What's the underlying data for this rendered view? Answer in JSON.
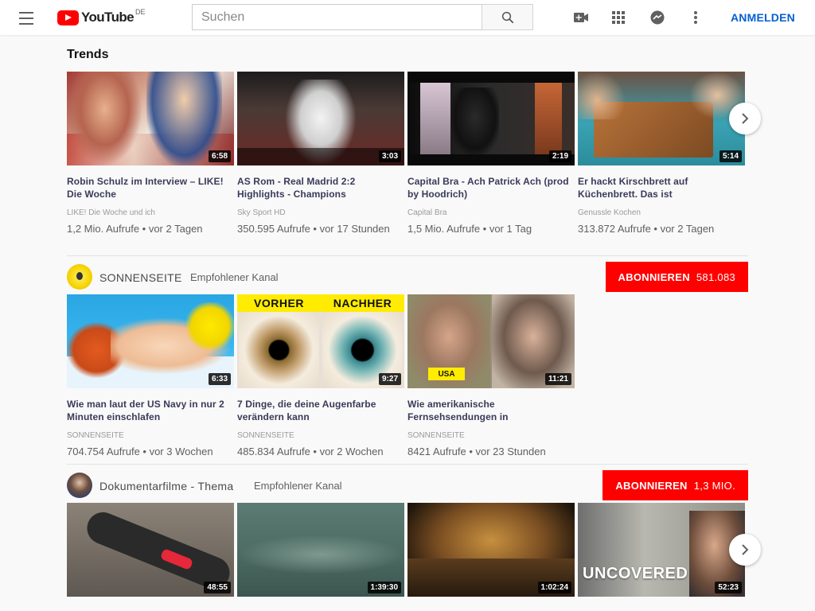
{
  "header": {
    "logo_text": "YouTube",
    "region": "DE",
    "search_placeholder": "Suchen",
    "signin_label": "ANMELDEN"
  },
  "trending": {
    "title": "Trends",
    "videos": [
      {
        "title": "Robin Schulz im Interview – LIKE! Die Woche",
        "channel": "LIKE! Die Woche und ich",
        "meta": "1,2 Mio. Aufrufe • vor 2 Tagen",
        "duration": "6:58"
      },
      {
        "title": "AS Rom - Real Madrid 2:2 Highlights - Champions",
        "channel": "Sky Sport HD",
        "meta": "350.595 Aufrufe • vor 17 Stunden",
        "duration": "3:03"
      },
      {
        "title": "Capital Bra - Ach Patrick Ach (prod by Hoodrich)",
        "channel": "Capital Bra",
        "meta": "1,5 Mio. Aufrufe • vor 1 Tag",
        "duration": "2:19"
      },
      {
        "title": "Er hackt Kirschbrett auf Küchenbrett. Das ist",
        "channel": "Genussle Kochen",
        "meta": "313.872 Aufrufe • vor 2 Tagen",
        "duration": "5:14"
      }
    ]
  },
  "channel1": {
    "name": "SONNENSEITE",
    "tag": "Empfohlener Kanal",
    "subscribe_label": "ABONNIEREN",
    "subscribe_count": "581.083",
    "videos": [
      {
        "title": "Wie man laut der US Navy in nur 2 Minuten einschlafen",
        "channel": "SONNENSEITE",
        "meta": "704.754 Aufrufe • vor 3 Wochen",
        "duration": "6:33"
      },
      {
        "title": "7 Dinge, die deine Augenfarbe verändern kann",
        "channel": "SONNENSEITE",
        "meta": "485.834 Aufrufe • vor 2 Wochen",
        "duration": "9:27",
        "banner_left": "VORHER",
        "banner_right": "NACHHER"
      },
      {
        "title": "Wie amerikanische Fernsehsendungen in",
        "channel": "SONNENSEITE",
        "meta": "8421 Aufrufe • vor 23 Stunden",
        "duration": "11:21",
        "badge_left": "USA"
      }
    ]
  },
  "channel2": {
    "name": "Dokumentarfilme - Thema",
    "tag": "Empfohlener Kanal",
    "subscribe_label": "ABONNIEREN",
    "subscribe_count": "1,3 MIO.",
    "videos": [
      {
        "duration": "48:55"
      },
      {
        "duration": "1:39:30"
      },
      {
        "duration": "1:02:24"
      },
      {
        "duration": "52:23",
        "overlay": "UNCOVERED"
      }
    ]
  },
  "colors": {
    "brand_red": "#ff0000",
    "link_blue": "#065fd4"
  }
}
